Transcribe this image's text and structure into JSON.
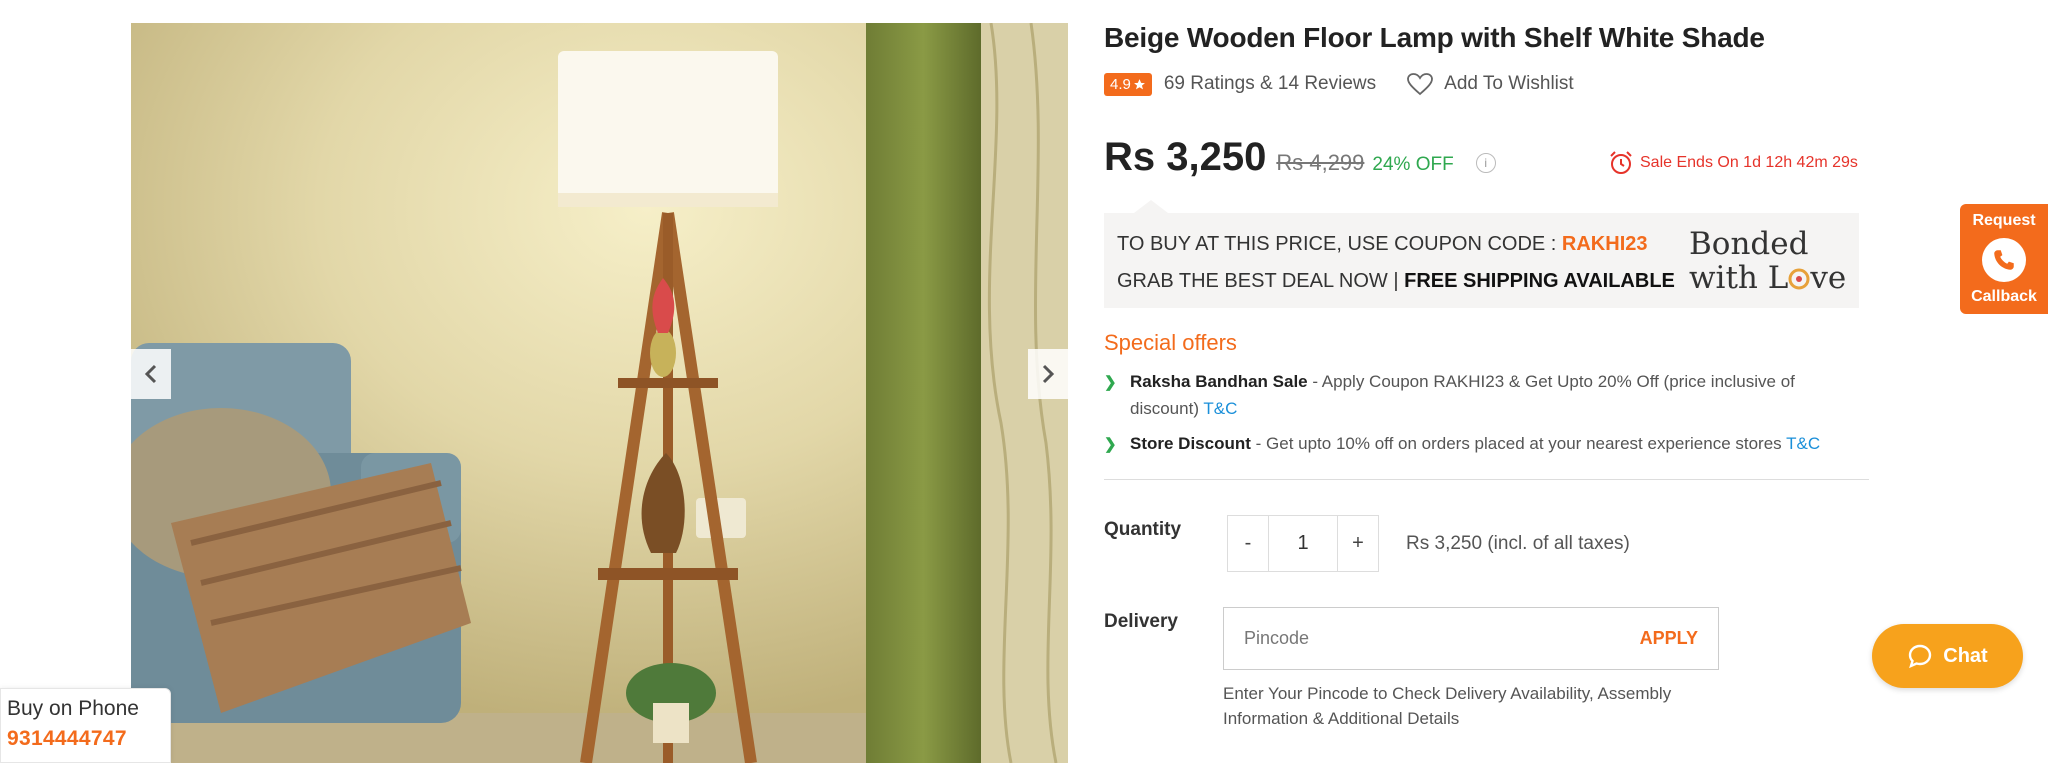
{
  "product": {
    "title": "Beige Wooden Floor Lamp with Shelf White Shade",
    "rating": "4.9",
    "rating_text": "69 Ratings & 14 Reviews",
    "wishlist_label": "Add To Wishlist",
    "price": "Rs 3,250",
    "mrp": "Rs 4,299",
    "discount": "24% OFF",
    "info_icon": "i",
    "sale_ends": "Sale Ends On 1d 12h 42m 29s"
  },
  "coupon": {
    "line1_prefix": "TO BUY AT THIS PRICE, USE COUPON CODE : ",
    "code": "RAKHI23",
    "line2_prefix": "GRAB THE BEST DEAL NOW | ",
    "line2_bold": "FREE SHIPPING AVAILABLE",
    "banner_line1": "Bonded",
    "banner_line2": "with L",
    "banner_line2_end": "ve"
  },
  "offers": {
    "title": "Special offers",
    "items": [
      {
        "name": "Raksha Bandhan Sale",
        "desc": " - Apply Coupon RAKHI23 & Get Upto 20% Off (price inclusive of discount) ",
        "tc": "T&C"
      },
      {
        "name": "Store Discount",
        "desc": " - Get upto 10% off on orders placed at your nearest experience stores ",
        "tc": "T&C"
      }
    ]
  },
  "quantity": {
    "label": "Quantity",
    "minus": "-",
    "value": "1",
    "plus": "+",
    "price_note": "Rs 3,250 (incl. of all taxes)"
  },
  "delivery": {
    "label": "Delivery",
    "placeholder": "Pincode",
    "apply": "APPLY",
    "note": "Enter Your Pincode to Check Delivery Availability, Assembly Information & Additional Details"
  },
  "widgets": {
    "callback_top": "Request",
    "callback_bottom": "Callback",
    "chat": "Chat",
    "phone_label": "Buy on Phone",
    "phone_number": "9314444747"
  },
  "colors": {
    "accent": "#f36b1c",
    "discount": "#2fa84f",
    "sale": "#e6332a",
    "link": "#1a8fd9",
    "chat": "#f7a21c"
  },
  "icons": [
    "chevron-left-icon",
    "chevron-right-icon",
    "star-icon",
    "heart-icon",
    "alarm-clock-icon",
    "phone-icon",
    "chat-bubble-icon"
  ]
}
